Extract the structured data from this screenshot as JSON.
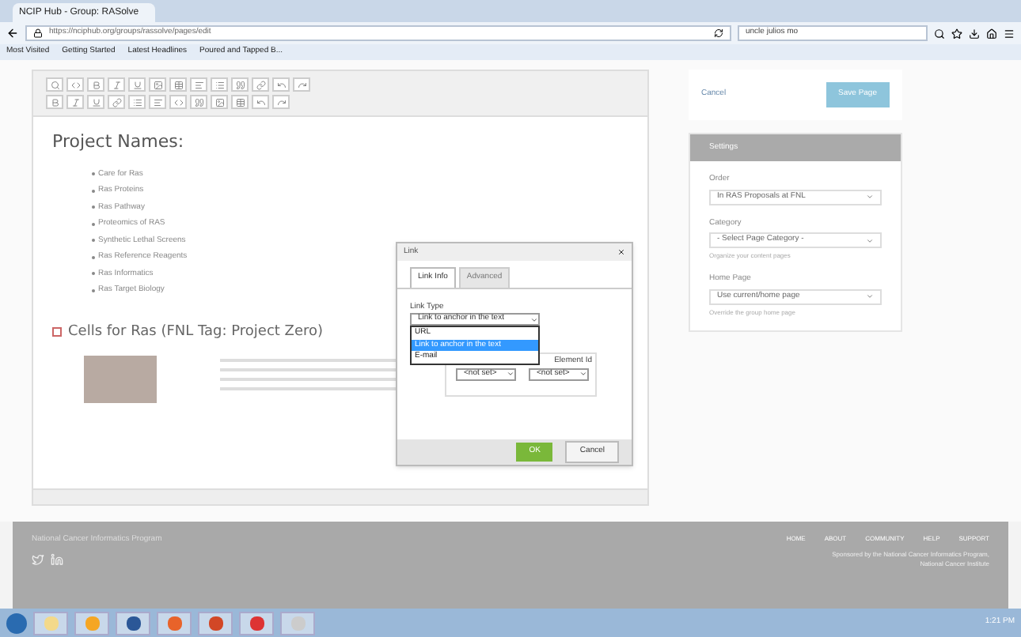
{
  "browser": {
    "tab_title": "NCIP Hub - Group: RASolve",
    "url": "https://nciphub.org/groups/rassolve/pages/edit",
    "search": "uncle julios mo",
    "bookmarks": [
      "Most Visited",
      "Getting Started",
      "Latest Headlines",
      "Poured and Tapped B..."
    ]
  },
  "editor": {
    "heading": "Project Names:",
    "list_items": [
      "Care for Ras",
      "Ras Proteins",
      "Ras Pathway",
      "Proteomics of RAS",
      "Synthetic Lethal Screens",
      "Ras Reference Reagents",
      "Ras Informatics",
      "Ras Target Biology"
    ],
    "section_title": "Cells for Ras (FNL Tag: Project Zero)"
  },
  "dialog": {
    "title": "Link",
    "tabs": [
      {
        "label": "Link Info",
        "selected": true
      },
      {
        "label": "Advanced",
        "selected": false
      }
    ],
    "link_type_label": "Link Type",
    "link_type_value": "Link to anchor in the text",
    "options": [
      {
        "label": "URL",
        "selected": false
      },
      {
        "label": "Link to anchor in the text",
        "selected": true
      },
      {
        "label": "E-mail",
        "selected": false
      }
    ],
    "element_label": "Element Id",
    "selects": [
      "<not set>",
      "<not set>"
    ],
    "buttons": [
      {
        "label": "OK",
        "kind": "primary"
      },
      {
        "label": "Cancel",
        "kind": "secondary"
      }
    ]
  },
  "sidebar": {
    "cancel": "Cancel",
    "save": "Save Page",
    "panel_title": "Settings",
    "fields": [
      {
        "label": "Order",
        "value": "In RAS Proposals at FNL"
      },
      {
        "label": "Category",
        "value": "- Select Page Category -",
        "help": "Organize your content pages"
      },
      {
        "label": "Home Page",
        "value": "Use current/home page",
        "help": "Override the group home page"
      }
    ]
  },
  "footer": {
    "title": "National Cancer Informatics Program",
    "links": [
      "HOME",
      "ABOUT",
      "COMMUNITY",
      "HELP",
      "SUPPORT"
    ],
    "sponsor": "Sponsored by the National Cancer Informatics Program, National Cancer Institute"
  },
  "taskbar": {
    "time": "1:21 PM"
  }
}
